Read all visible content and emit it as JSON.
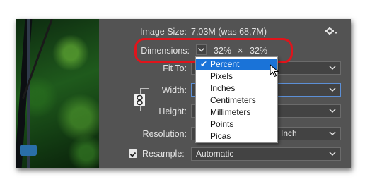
{
  "image_size": {
    "label": "Image Size:",
    "value": "7,03M (was 68,7M)"
  },
  "dimensions": {
    "label": "Dimensions:",
    "width": "32%",
    "separator": "×",
    "height": "32%"
  },
  "fit_to": {
    "label": "Fit To:"
  },
  "width": {
    "label": "Width:"
  },
  "height": {
    "label": "Height:"
  },
  "resolution": {
    "label": "Resolution:",
    "unit": "Inch"
  },
  "resample": {
    "label": "Resample:",
    "checked": true,
    "value": "Automatic"
  },
  "unit_menu": {
    "selected": "Percent",
    "options": [
      "Percent",
      "Pixels",
      "Inches",
      "Centimeters",
      "Millimeters",
      "Points",
      "Picas"
    ]
  },
  "icons": [
    "gear-icon",
    "chevron-down-icon",
    "link-icon",
    "checkmark-icon",
    "mouse-cursor-icon"
  ],
  "colors": {
    "panel": "#535353",
    "highlight": "#1a73d8",
    "annotation": "#e0141b"
  }
}
